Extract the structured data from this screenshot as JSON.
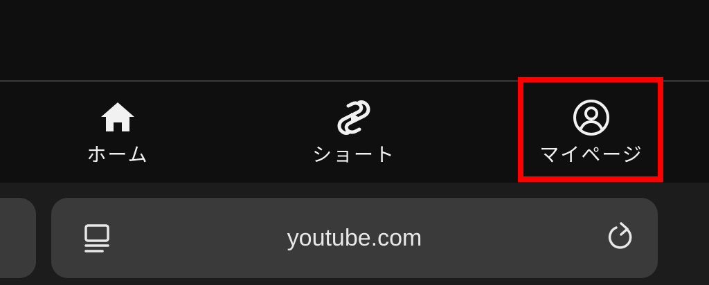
{
  "nav": {
    "items": [
      {
        "label": "ホーム",
        "icon": "home-icon"
      },
      {
        "label": "ショート",
        "icon": "shorts-icon"
      },
      {
        "label": "マイページ",
        "icon": "account-circle-icon"
      }
    ]
  },
  "highlight": {
    "color": "#ff0000",
    "target": "nav-item-mypage"
  },
  "browser": {
    "url": "youtube.com",
    "left_icon": "reader-mode-icon",
    "right_icon": "reload-icon"
  },
  "colors": {
    "background": "#0f0f0f",
    "toolbar": "#1c1c1c",
    "pill": "#3a3a3a",
    "text": "#f1f1f1"
  }
}
